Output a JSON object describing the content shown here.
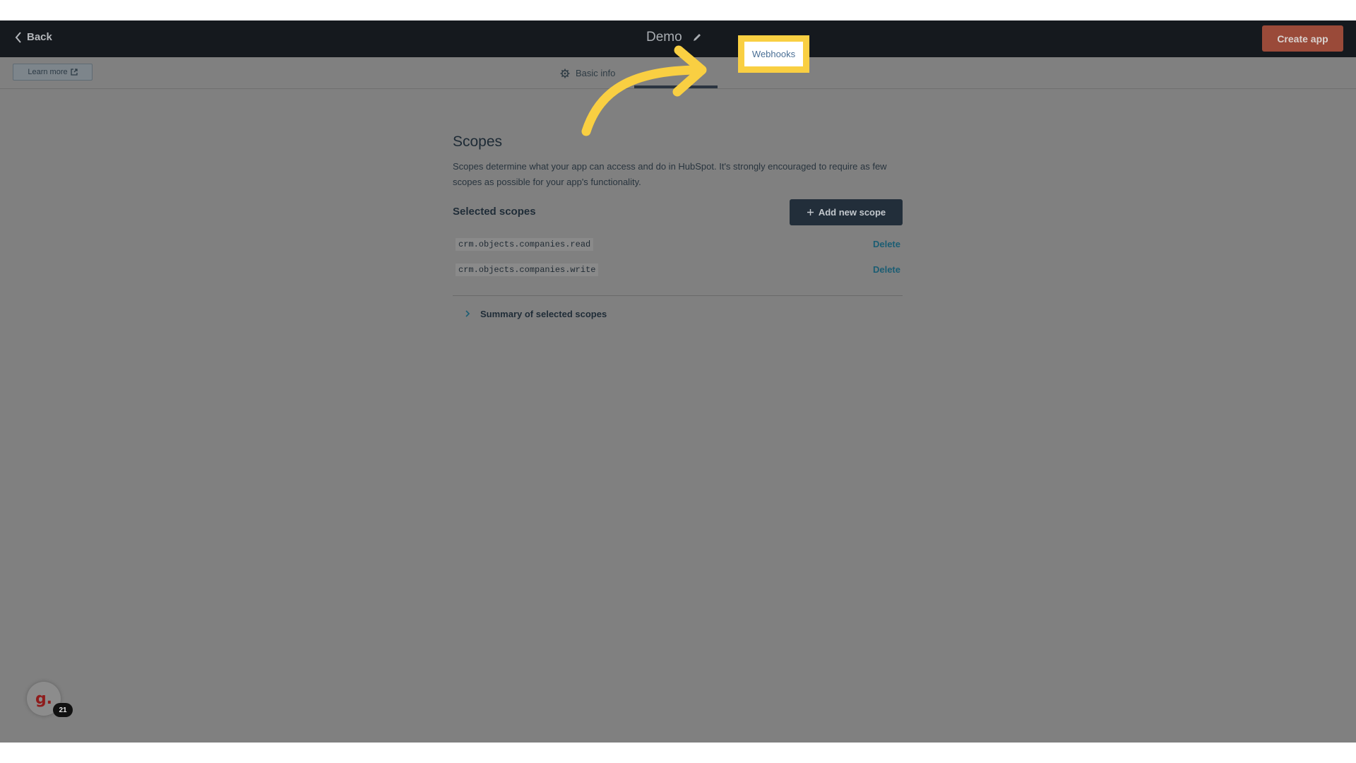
{
  "topbar": {
    "back_label": "Back",
    "app_title": "Demo",
    "create_label": "Create app"
  },
  "tabs": {
    "learn_more": "Learn more",
    "basic_info": "Basic info",
    "webhooks": "Webhooks"
  },
  "scopes": {
    "heading": "Scopes",
    "description": "Scopes determine what your app can access and do in HubSpot. It's strongly encouraged to require as few scopes as possible for your app's functionality.",
    "selected_title": "Selected scopes",
    "add_label": "Add new scope",
    "items": [
      {
        "code": "crm.objects.companies.read",
        "action": "Delete"
      },
      {
        "code": "crm.objects.companies.write",
        "action": "Delete"
      }
    ],
    "summary_label": "Summary of selected scopes"
  },
  "avatar": {
    "letter": "g.",
    "badge": "21"
  },
  "colors": {
    "highlight": "#f9cf42",
    "topbar": "#15191e",
    "create_button": "#9a4a39",
    "add_button": "#222e3a",
    "delete_link": "#1b5d73"
  }
}
